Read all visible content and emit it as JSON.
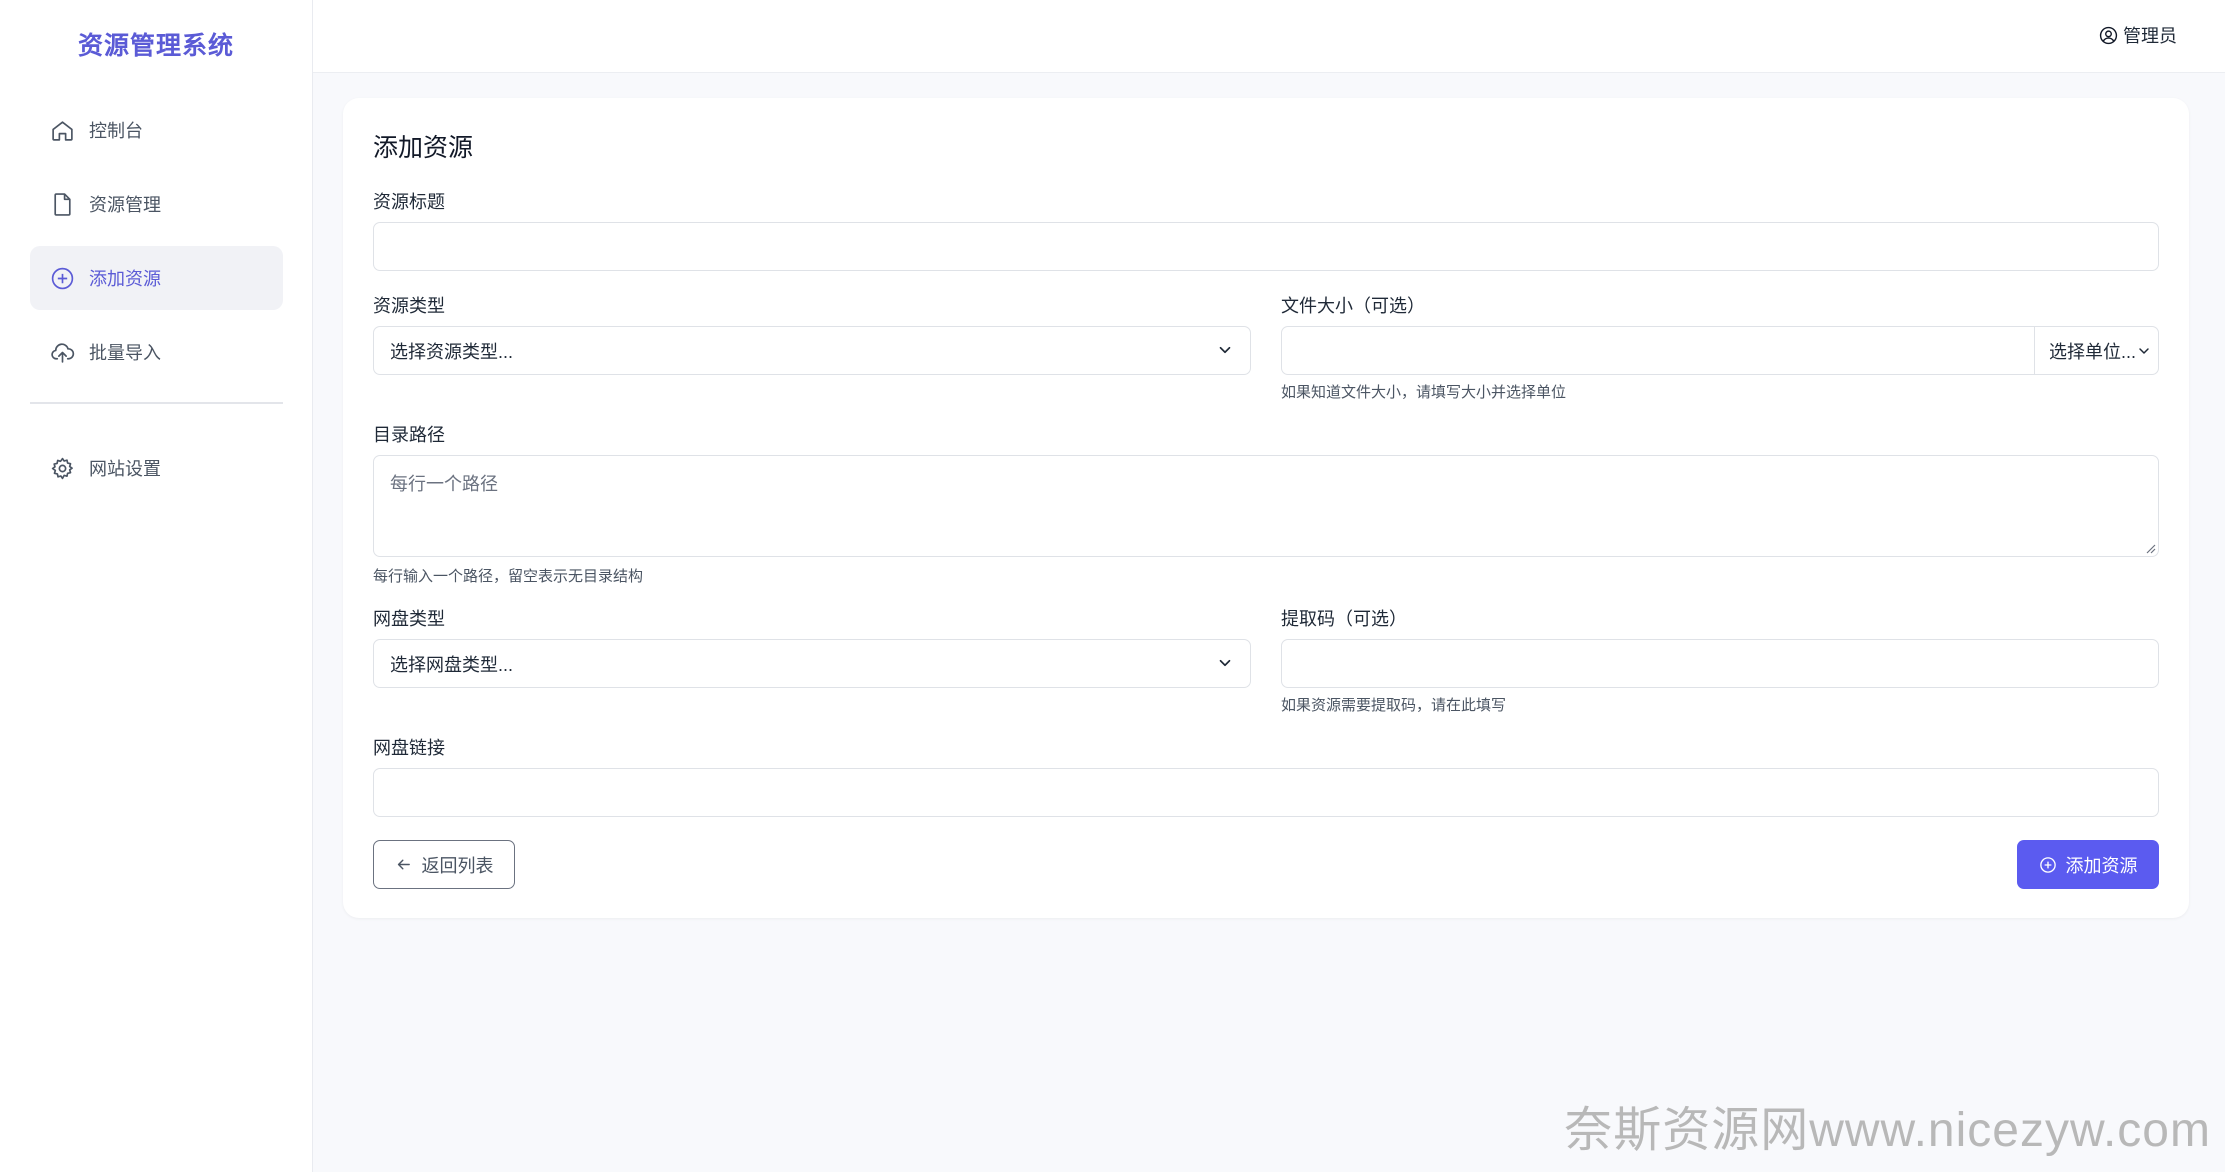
{
  "sidebar": {
    "brand": "资源管理系统",
    "items": [
      {
        "label": "控制台",
        "icon": "home-icon"
      },
      {
        "label": "资源管理",
        "icon": "file-icon"
      },
      {
        "label": "添加资源",
        "icon": "plus-circle-icon",
        "active": true
      },
      {
        "label": "批量导入",
        "icon": "cloud-upload-icon"
      },
      {
        "label": "网站设置",
        "icon": "gear-icon"
      }
    ]
  },
  "header": {
    "user_label": "管理员"
  },
  "form": {
    "title": "添加资源",
    "resource_title": {
      "label": "资源标题",
      "value": ""
    },
    "resource_type": {
      "label": "资源类型",
      "selected": "选择资源类型..."
    },
    "file_size": {
      "label": "文件大小（可选）",
      "value": "",
      "unit_selected": "选择单位...",
      "hint": "如果知道文件大小，请填写大小并选择单位"
    },
    "dir_path": {
      "label": "目录路径",
      "placeholder": "每行一个路径",
      "hint": "每行输入一个路径，留空表示无目录结构"
    },
    "disk_type": {
      "label": "网盘类型",
      "selected": "选择网盘类型..."
    },
    "extract_code": {
      "label": "提取码（可选）",
      "value": "",
      "hint": "如果资源需要提取码，请在此填写"
    },
    "disk_link": {
      "label": "网盘链接",
      "value": ""
    },
    "back_button": "返回列表",
    "submit_button": "添加资源"
  },
  "watermark": "奈斯资源网www.nicezyw.com",
  "colors": {
    "accent": "#5b5bf0",
    "brand": "#5b5bd6"
  }
}
